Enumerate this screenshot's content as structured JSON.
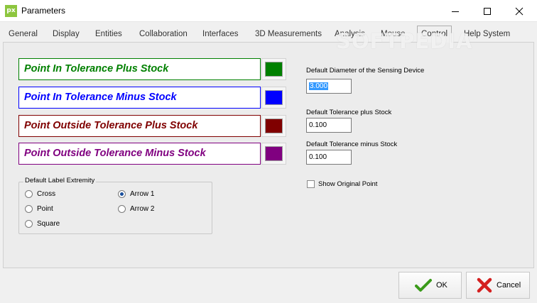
{
  "window": {
    "title": "Parameters",
    "app_icon": "px"
  },
  "tabs": [
    {
      "label": "General"
    },
    {
      "label": "Display"
    },
    {
      "label": "Entities"
    },
    {
      "label": "Collaboration"
    },
    {
      "label": "Interfaces"
    },
    {
      "label": "3D Measurements"
    },
    {
      "label": "Analysis"
    },
    {
      "label": "Mouse"
    },
    {
      "label": "Control",
      "active": true
    },
    {
      "label": "Help System"
    }
  ],
  "watermark": "SOFTPEDIA",
  "tolerance_boxes": [
    {
      "label": "Point In Tolerance Plus Stock",
      "color": "#008000"
    },
    {
      "label": "Point In Tolerance Minus Stock",
      "color": "#0000ff"
    },
    {
      "label": "Point Outside Tolerance Plus Stock",
      "color": "#800000"
    },
    {
      "label": "Point Outside Tolerance Minus Stock",
      "color": "#800080"
    }
  ],
  "label_extremity": {
    "title": "Default Label Extremity",
    "options": [
      {
        "label": "Cross",
        "checked": false
      },
      {
        "label": "Point",
        "checked": false
      },
      {
        "label": "Square",
        "checked": false
      },
      {
        "label": "Arrow 1",
        "checked": true
      },
      {
        "label": "Arrow 2",
        "checked": false
      }
    ]
  },
  "fields": {
    "diameter_label": "Default Diameter of the Sensing Device",
    "diameter_value": "3.000",
    "tol_plus_label": "Default Tolerance plus Stock",
    "tol_plus_value": "0.100",
    "tol_minus_label": "Default Tolerance minus Stock",
    "tol_minus_value": "0.100"
  },
  "show_original_point": {
    "label": "Show Original Point",
    "checked": false
  },
  "buttons": {
    "ok": "OK",
    "cancel": "Cancel"
  }
}
